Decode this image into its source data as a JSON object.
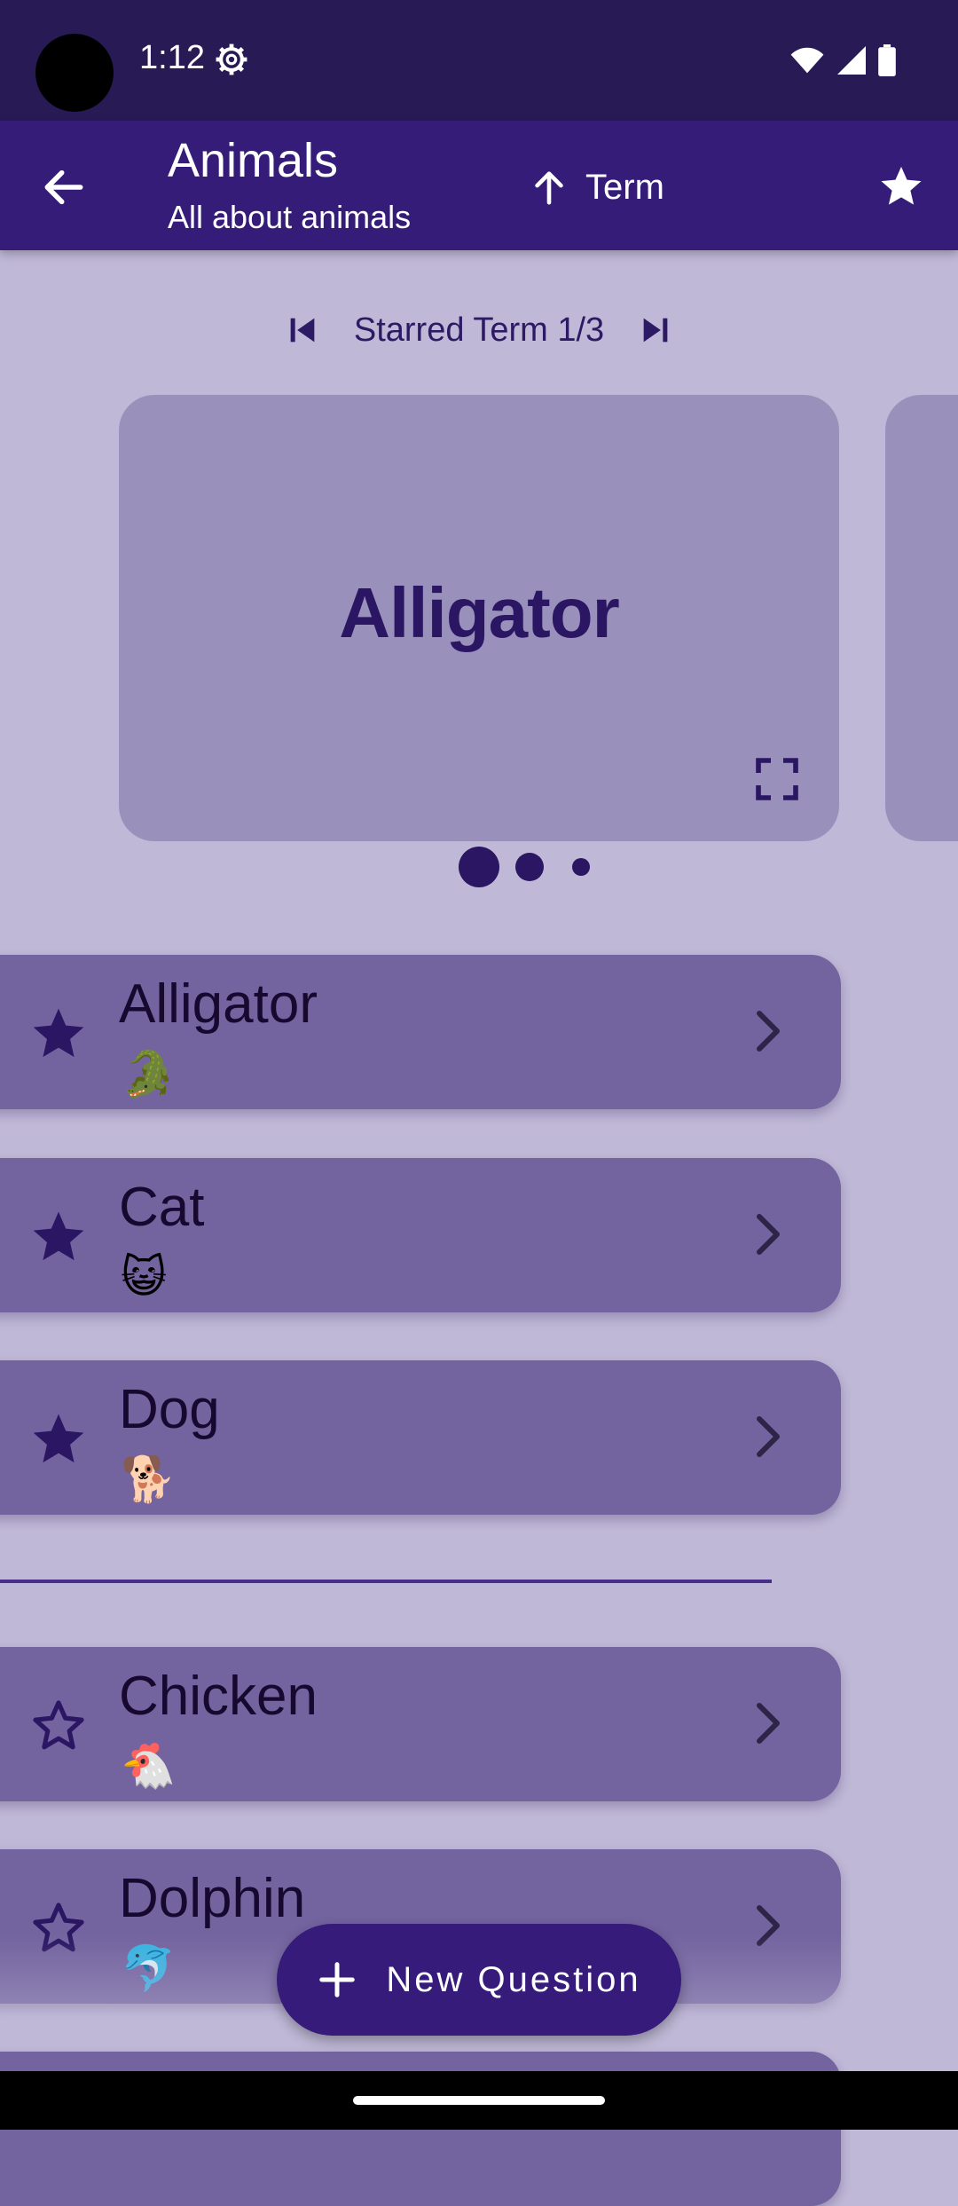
{
  "status_bar": {
    "time": "1:12"
  },
  "app_bar": {
    "title": "Animals",
    "subtitle": "All about animals",
    "sort_label": "Term"
  },
  "navigator": {
    "label": "Starred Term 1/3"
  },
  "flashcard": {
    "term": "Alligator"
  },
  "items": [
    {
      "term": "Alligator",
      "emoji": "🐊",
      "starred": true
    },
    {
      "term": "Cat",
      "emoji": "😺",
      "starred": true
    },
    {
      "term": "Dog",
      "emoji": "🐕",
      "starred": true
    },
    {
      "term": "Chicken",
      "emoji": "🐔",
      "starred": false
    },
    {
      "term": "Dolphin",
      "emoji": "🐬",
      "starred": false
    }
  ],
  "fab": {
    "label": "New Question"
  },
  "colors": {
    "status_bar": "#281a55",
    "app_bar": "#351c78",
    "background": "#bfb8d6",
    "card": "#9a90bc",
    "list_item": "#73639f",
    "accent_dark": "#2a1662"
  }
}
